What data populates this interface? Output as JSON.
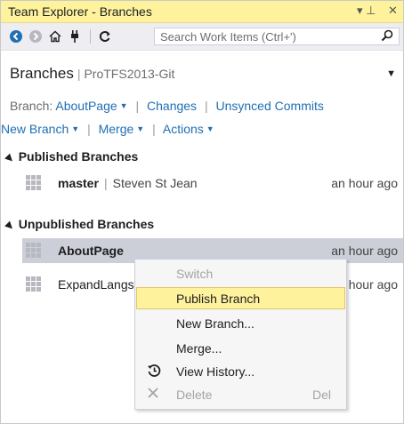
{
  "window": {
    "title": "Team Explorer - Branches",
    "pin_glyph": "▾ ⊥",
    "close_glyph": "✕"
  },
  "toolbar": {
    "search_placeholder": "Search Work Items (Ctrl+')"
  },
  "header": {
    "title": "Branches",
    "project": "ProTFS2013-Git"
  },
  "nav": {
    "branch_label": "Branch:",
    "branch_value": "AboutPage",
    "changes": "Changes",
    "unsynced": "Unsynced Commits",
    "new_branch": "New Branch",
    "merge": "Merge",
    "actions": "Actions"
  },
  "published": {
    "header": "Published Branches",
    "items": [
      {
        "name": "master",
        "author": "Steven St Jean",
        "time": "an hour ago"
      }
    ]
  },
  "unpublished": {
    "header": "Unpublished Branches",
    "items": [
      {
        "name": "AboutPage",
        "time": "an hour ago",
        "selected": true
      },
      {
        "name": "ExpandLangs",
        "visible_name": "ExpandLangs",
        "time_visible": "hour ago"
      }
    ]
  },
  "context_menu": {
    "items": [
      {
        "label": "Switch",
        "enabled": false
      },
      {
        "label": "Publish Branch",
        "enabled": true,
        "highlighted": true
      },
      {
        "label": "New Branch...",
        "enabled": true
      },
      {
        "label": "Merge...",
        "enabled": true
      },
      {
        "label": "View History...",
        "enabled": true,
        "icon": "history-icon"
      },
      {
        "label": "Delete",
        "enabled": false,
        "icon": "delete-icon",
        "shortcut": "Del"
      }
    ]
  },
  "colors": {
    "title_bar": "#fff29d",
    "link": "#1e6fb4",
    "selection": "#ccced8",
    "menu_highlight": "#fff29d"
  }
}
